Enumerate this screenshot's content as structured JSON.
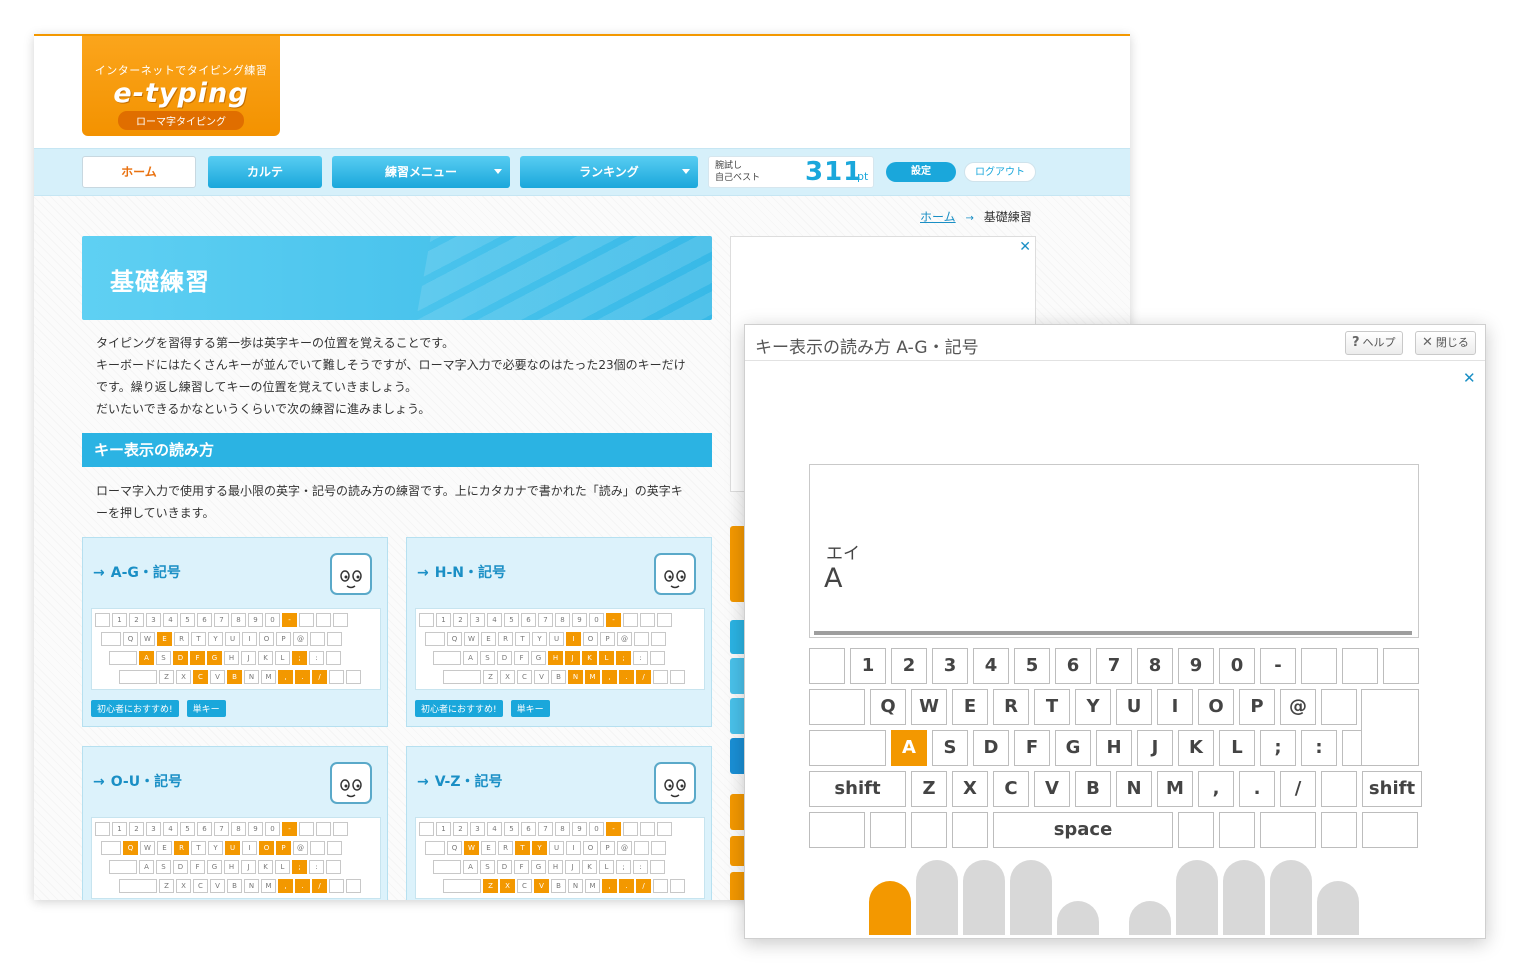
{
  "logo": {
    "tagline": "インターネットでタイピング練習",
    "brand": "e-typing",
    "subtitle": "ローマ字タイピング"
  },
  "nav": {
    "home": "ホーム",
    "karte": "カルテ",
    "practice_menu": "練習メニュー",
    "ranking": "ランキング",
    "best_label_1": "腕試し",
    "best_label_2": "自己ベスト",
    "best_score": "311",
    "best_unit": "pt",
    "settings": "設定",
    "logout": "ログアウト"
  },
  "breadcrumb": {
    "home": "ホーム",
    "arrow": "→",
    "current": "基礎練習"
  },
  "banner": {
    "title": "基礎練習"
  },
  "intro": {
    "line1": "タイピングを習得する第一歩は英字キーの位置を覚えることです。",
    "line2": "キーボードにはたくさんキーが並んでいて難しそうですが、ローマ字入力で必要なのはたった23個のキーだけ",
    "line3": "です。繰り返し練習してキーの位置を覚えていきましょう。",
    "line4": "だいたいできるかなというくらいで次の練習に進みましょう。"
  },
  "section": {
    "heading": "キー表示の読み方",
    "desc1": "ローマ字入力で使用する最小限の英字・記号の読み方の練習です。上にカタカナで書かれた「読み」の英字キ",
    "desc2": "ーを押していきます。"
  },
  "cards": [
    {
      "title": "A-G・記号",
      "tag1": "初心者におすすめ!",
      "tag2": "単キー"
    },
    {
      "title": "H-N・記号",
      "tag1": "初心者におすすめ!",
      "tag2": "単キー"
    },
    {
      "title": "O-U・記号"
    },
    {
      "title": "V-Z・記号"
    }
  ],
  "card_arrow": "→",
  "dialog": {
    "title": "キー表示の読み方 A-G・記号",
    "help": "ヘルプ",
    "help_icon": "?",
    "close": "閉じる",
    "close_icon": "✕",
    "dismiss_icon": "✕",
    "yomi": "エイ",
    "char": "A"
  },
  "keyboard": {
    "row1": [
      "",
      "1",
      "2",
      "3",
      "4",
      "5",
      "6",
      "7",
      "8",
      "9",
      "0",
      "-",
      "",
      "",
      ""
    ],
    "row2": [
      "",
      "Q",
      "W",
      "E",
      "R",
      "T",
      "Y",
      "U",
      "I",
      "O",
      "P",
      "@",
      ""
    ],
    "row3": [
      "",
      "A",
      "S",
      "D",
      "F",
      "G",
      "H",
      "J",
      "K",
      "L",
      ";",
      ":",
      ""
    ],
    "row4": [
      "shift",
      "Z",
      "X",
      "C",
      "V",
      "B",
      "N",
      "M",
      ",",
      ".",
      "/",
      "",
      "shift"
    ],
    "row5": [
      "",
      "",
      "",
      "",
      "space",
      "",
      "",
      "",
      "",
      ""
    ],
    "highlighted_key": "A",
    "highlight_color": "#f39800"
  },
  "fingers": {
    "active_finger": "left-pinky",
    "active_color": "#f39800",
    "idle_color": "#d8d8d8"
  },
  "colors": {
    "accent_orange": "#f39800",
    "accent_blue": "#1aa7db",
    "nav_bg": "#d6f0fa"
  }
}
